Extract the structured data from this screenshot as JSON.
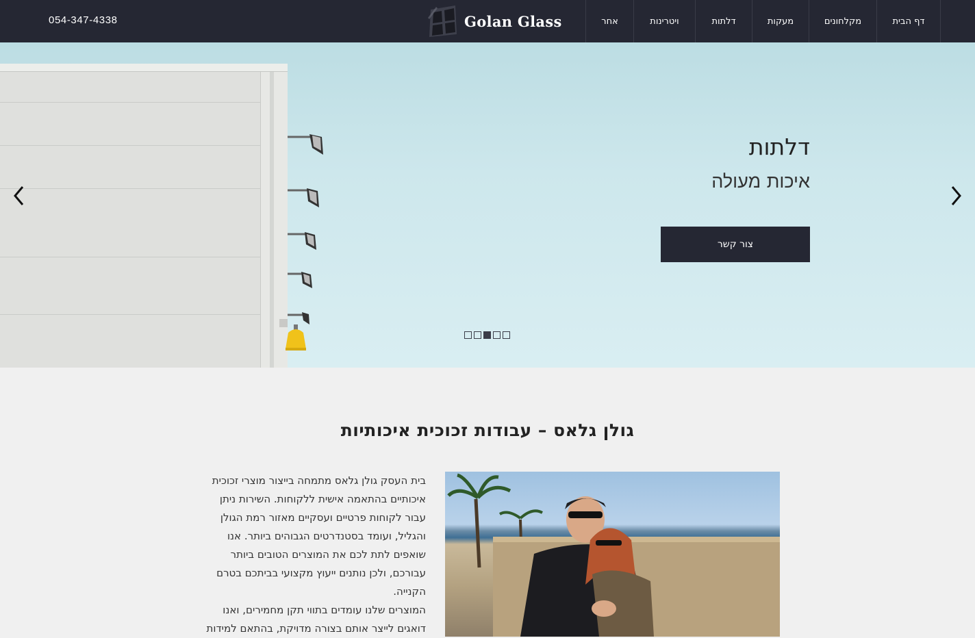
{
  "header": {
    "phone": "054-347-4338",
    "logo_text": "Golan Glass",
    "nav": [
      "אחר",
      "ויטרינות",
      "דלתות",
      "מעקות",
      "מקלחונים",
      "דף הבית"
    ],
    "active_nav": "דלתות"
  },
  "hero": {
    "title": "דלתות",
    "subtitle": "איכות מעולה",
    "button_label": "צור קשר",
    "slide_count": 5,
    "active_slide": 3
  },
  "main": {
    "title": "גולן גלאס – עבודות זכוכית איכותיות",
    "paragraph_lines": [
      "בית העסק גולן גלאס מתמחה בייצור מוצרי זכוכית",
      "איכותיים בהתאמה אישית ללקוחות. השירות ניתן",
      "עבור לקוחות פרטיים ועסקיים מאזור רמת הגולן",
      "והגליל, ועומד בסטנדרטים הגבוהים ביותר. אנו",
      "שואפים לתת לכם את המוצרים הטובים ביותר",
      "עבורכם, ולכן נותנים ייעוץ מקצועי בביתכם בטרם",
      "הקנייה.",
      "המוצרים שלנו עומדים בתווי תקן מחמירים, ואנו",
      "דואגים לייצר אותם בצורה מדויקת, בהתאם למידות"
    ]
  },
  "colors": {
    "header_bg": "#252733",
    "hero_sky": "#cde7ec",
    "page_bg": "#f0f0f0"
  }
}
